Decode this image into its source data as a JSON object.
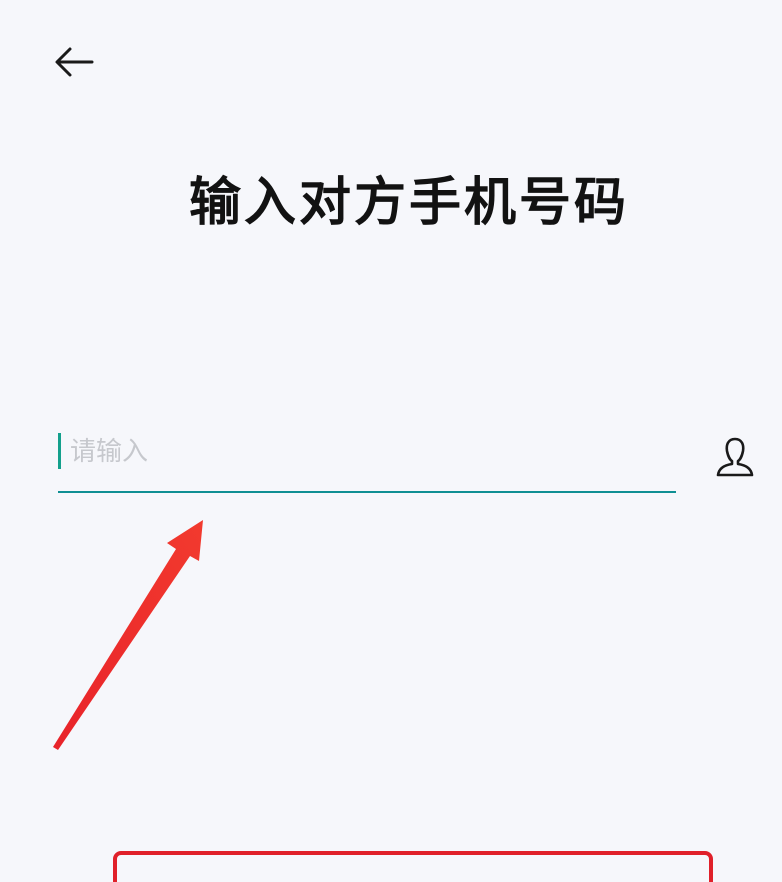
{
  "header": {
    "back_icon": "arrow-left-icon"
  },
  "page": {
    "title": "输入对方手机号码"
  },
  "phone_input": {
    "value": "",
    "placeholder": "请输入"
  },
  "contact_picker": {
    "icon": "person-icon"
  },
  "colors": {
    "background": "#f6f7fb",
    "accent": "#0f8f93",
    "annotation": "#e0202a"
  }
}
